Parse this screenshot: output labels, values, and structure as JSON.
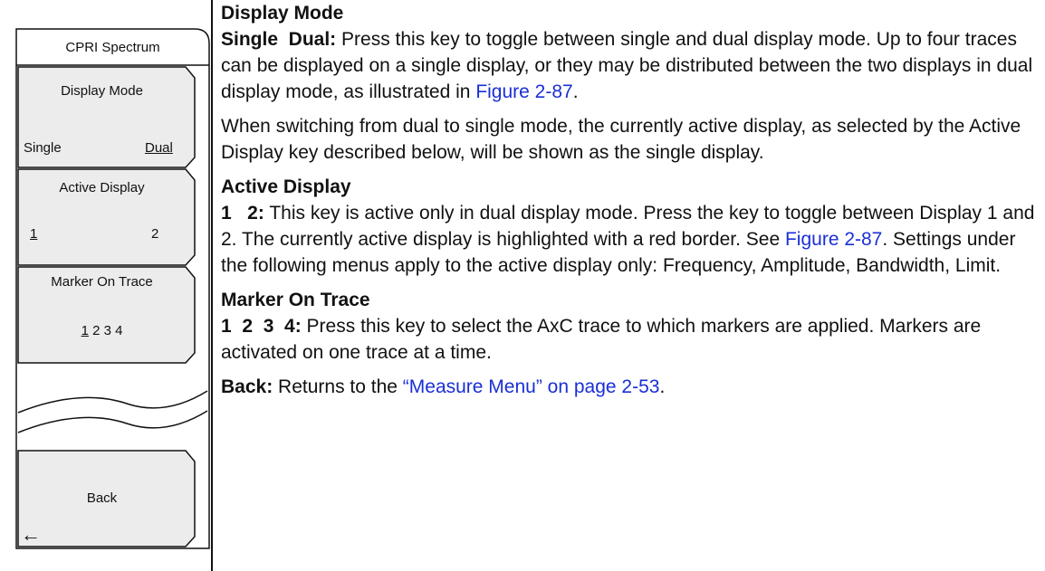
{
  "menu": {
    "title": "CPRI Spectrum",
    "display_mode": {
      "label": "Display Mode",
      "opt1": "Single",
      "opt2": "Dual"
    },
    "active_display": {
      "label": "Active Display",
      "opt1": "1",
      "opt2": "2"
    },
    "marker_on_trace": {
      "label": "Marker On Trace",
      "opt1": "1",
      "opt_rest": " 2 3 4"
    },
    "back": {
      "label": "Back",
      "arrow": "←"
    }
  },
  "content": {
    "display_mode": {
      "heading": "Display Mode",
      "key": "Single  Dual:",
      "text1": " Press this key to toggle between single and dual display mode. Up to four traces can be displayed on a single display, or they may be distributed between the two displays in dual display mode, as illustrated in ",
      "link": "Figure 2-87",
      "text1_end": ".",
      "text2": "When switching from dual to single mode, the currently active display, as selected by the Active Display key described below, will be shown as the single display."
    },
    "active_display": {
      "heading": "Active Display",
      "key": "1   2:",
      "text1": " This key is active only in dual display mode. Press the key to toggle between Display 1 and 2. The currently active display is highlighted with a red border. See ",
      "link": "Figure 2-87",
      "text1_end": ". Settings under the following menus apply to the active display only: Frequency, Amplitude, Bandwidth, Limit."
    },
    "marker_on_trace": {
      "heading": "Marker On Trace",
      "key": "1  2  3  4:",
      "text1": " Press this key to select the AxC trace to which markers are applied. Markers are activated on one trace at a time."
    },
    "back": {
      "key": "Back:",
      "text1": " Returns to the ",
      "link": "“Measure Menu” on page 2-53",
      "text1_end": "."
    }
  }
}
